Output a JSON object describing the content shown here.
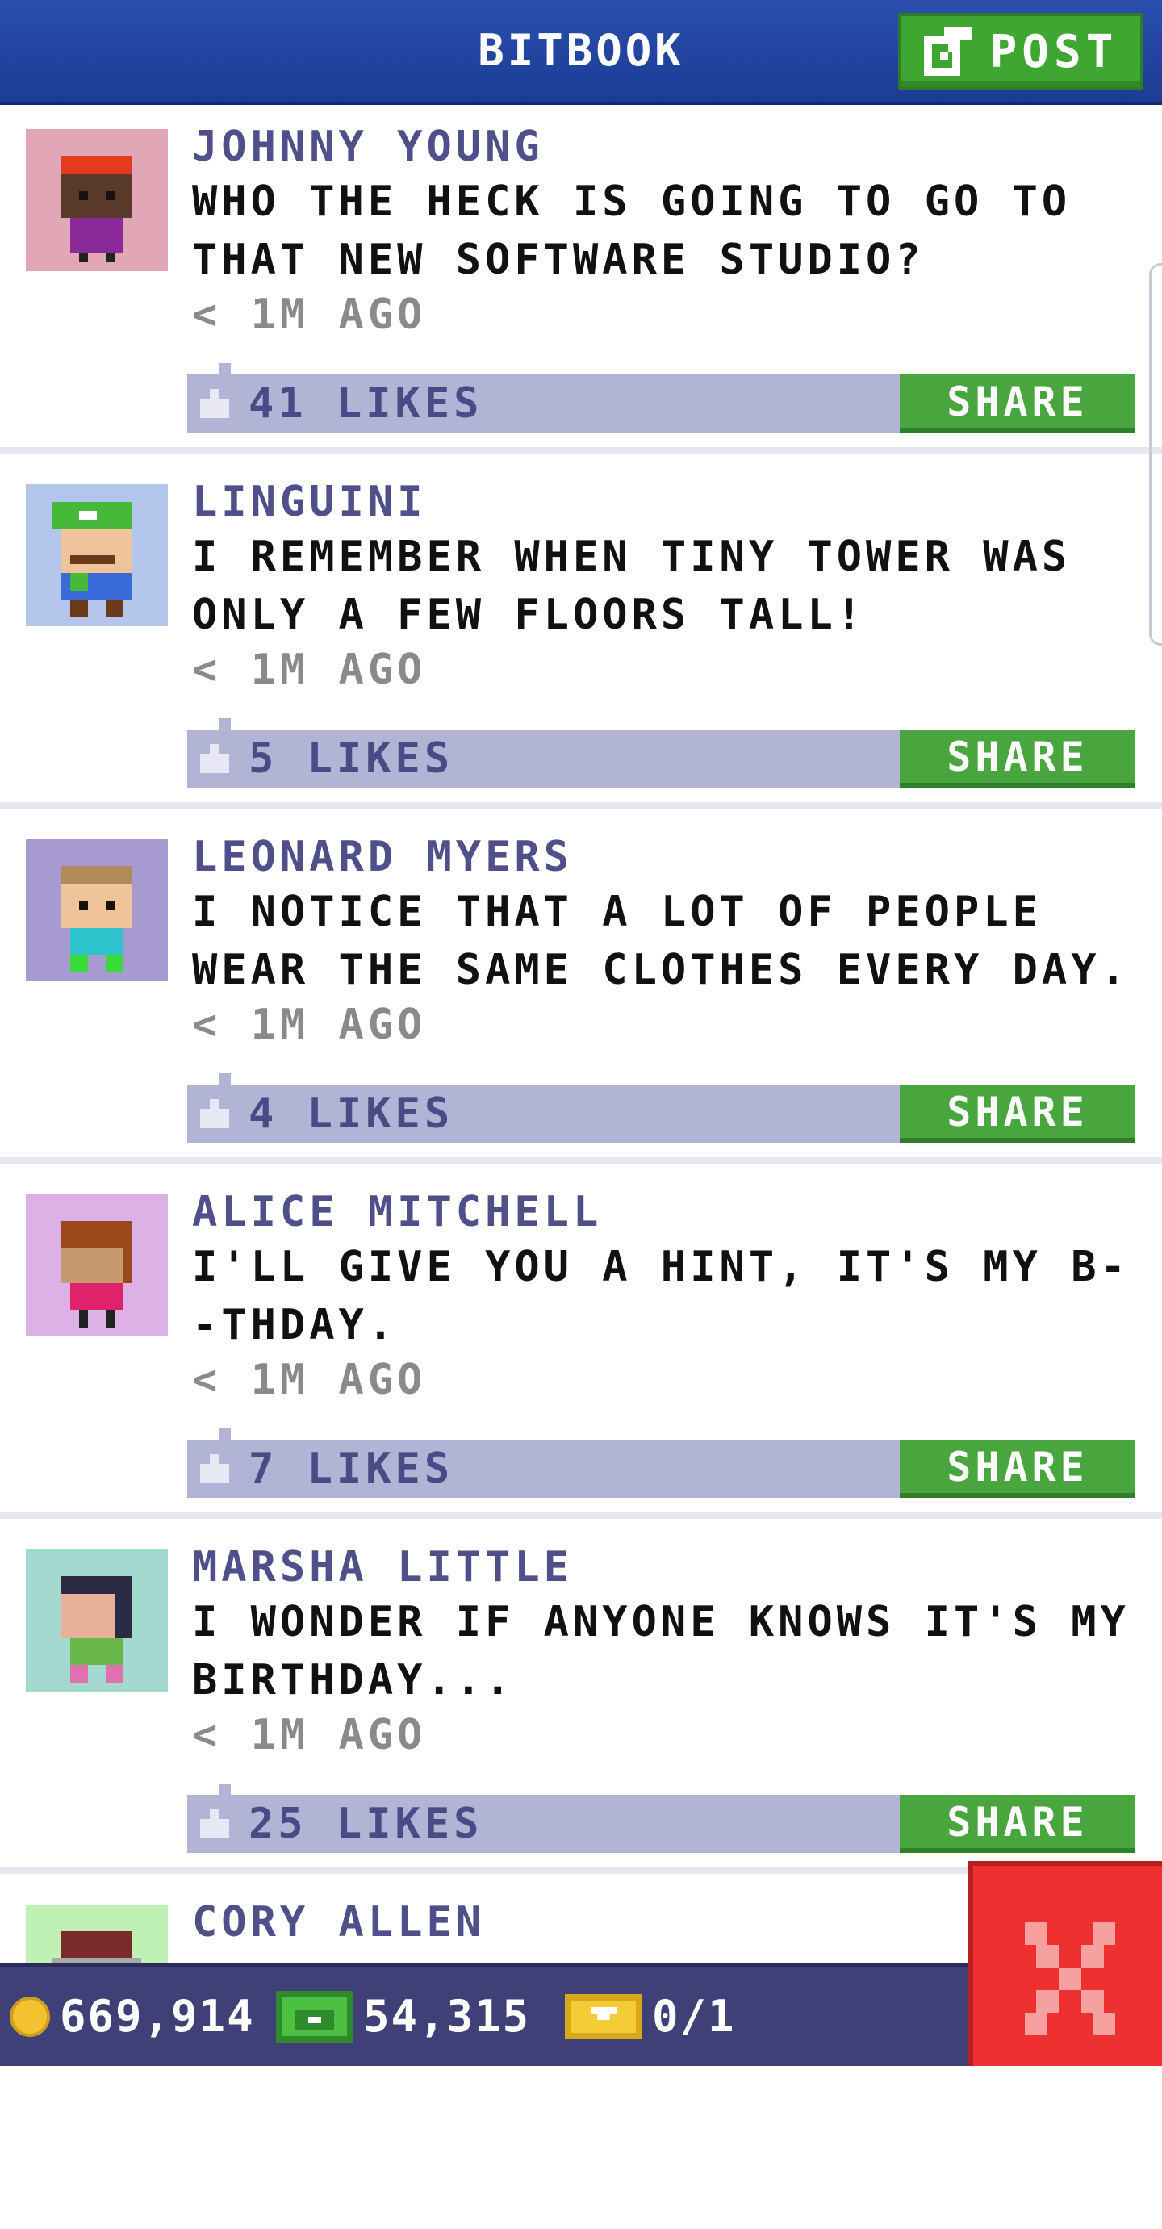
{
  "header": {
    "title": "BITBOOK",
    "post_label": "POST"
  },
  "posts": [
    {
      "author": "JOHNNY YOUNG",
      "message": "WHO THE HECK IS GOING TO GO TO THAT NEW SOFTWARE STUDIO?",
      "time": "< 1M AGO",
      "likes": "41 LIKES",
      "share_label": "SHARE",
      "avatar_color": "#e2a7b6"
    },
    {
      "author": "LINGUINI",
      "message": "I REMEMBER WHEN TINY TOWER WAS ONLY A FEW FLOORS TALL!",
      "time": "< 1M AGO",
      "likes": "5 LIKES",
      "share_label": "SHARE",
      "avatar_color": "#b4c6ec"
    },
    {
      "author": "LEONARD MYERS",
      "message": "I NOTICE THAT A LOT OF PEOPLE WEAR THE SAME CLOTHES EVERY DAY.",
      "time": "< 1M AGO",
      "likes": "4 LIKES",
      "share_label": "SHARE",
      "avatar_color": "#a79ad1"
    },
    {
      "author": "ALICE MITCHELL",
      "message": "I'LL GIVE YOU A HINT, IT'S MY B--THDAY.",
      "time": "< 1M AGO",
      "likes": "7 LIKES",
      "share_label": "SHARE",
      "avatar_color": "#ddb1e6"
    },
    {
      "author": "MARSHA LITTLE",
      "message": "I WONDER IF ANYONE KNOWS IT'S MY BIRTHDAY...",
      "time": "< 1M AGO",
      "likes": "25 LIKES",
      "share_label": "SHARE",
      "avatar_color": "#a3d9cf"
    },
    {
      "author": "CORY ALLEN",
      "message": "",
      "time": "",
      "likes": "",
      "share_label": "",
      "avatar_color": "#bff0b4"
    }
  ],
  "status": {
    "coins": "669,914",
    "bux": "54,315",
    "tickets": "0/1"
  },
  "icons": {
    "post": "edit-icon",
    "like": "thumbs-up-icon",
    "coin": "coin-icon",
    "bux": "bux-icon",
    "ticket": "ticket-icon",
    "close": "close-icon"
  },
  "colors": {
    "header": "#1f3f9a",
    "accent_green": "#49a63e",
    "likes_bar": "#b2b4d6",
    "bottom_bar": "#3f4078",
    "close_red": "#ee3030"
  }
}
